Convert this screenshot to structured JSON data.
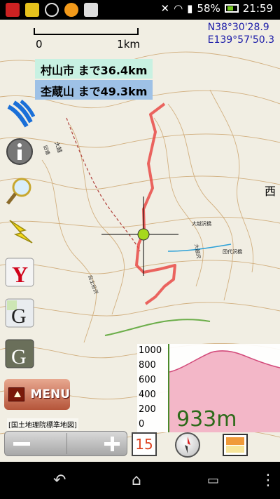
{
  "status_bar": {
    "battery_percent": "58%",
    "time": "21:59",
    "icons": [
      "app-icon",
      "monkey-icon",
      "crosshair-icon",
      "avast-icon",
      "clipboard-icon",
      "bluetooth-muted-icon",
      "wifi-icon",
      "signal-icon",
      "battery-icon"
    ]
  },
  "map": {
    "scale": {
      "zero_label": "0",
      "distance_label": "1km"
    },
    "coordinates": {
      "lat": "N38°30'28.9",
      "lon": "E139°57'50.3"
    },
    "distances": [
      {
        "text": "村山市 まで36.4km"
      },
      {
        "text": "杢蔵山 まで49.3km"
      }
    ],
    "side_char": "西",
    "place_labels": [
      "大越沢橋",
      "大越沢",
      "団代沢橋",
      "白土谷沢",
      "大越",
      "旧道"
    ],
    "source_label": "[国土地理院標準地図]",
    "zoom_level": "15",
    "colors": {
      "track": "#e8403c",
      "contour": "#c79a5e",
      "position_marker": "#a6d81d"
    }
  },
  "side_buttons": [
    {
      "name": "ski-resort-icon"
    },
    {
      "name": "info-icon"
    },
    {
      "name": "search-icon"
    },
    {
      "name": "lightning-icon"
    },
    {
      "name": "yahoo-icon"
    },
    {
      "name": "google-maps-icon"
    },
    {
      "name": "google-satellite-icon"
    }
  ],
  "menu": {
    "label": "MENU"
  },
  "elevation": {
    "ticks": [
      "1000",
      "800",
      "600",
      "400",
      "200",
      "0"
    ],
    "current": "933m",
    "profile_fill": "#f3b7c8",
    "profile_stroke": "#d24a7a"
  },
  "nav_bar": {
    "icons": [
      "back-icon",
      "home-icon",
      "recents-icon",
      "overflow-menu-icon"
    ]
  }
}
